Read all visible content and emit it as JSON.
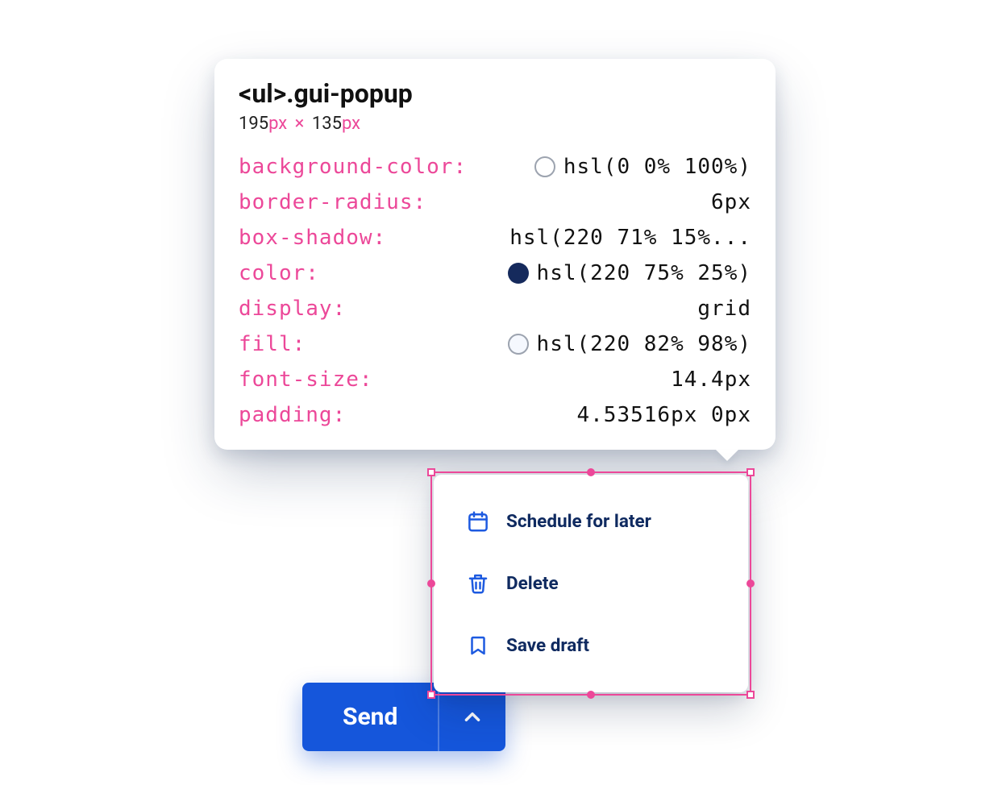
{
  "tooltip": {
    "element_tag": "<ul>",
    "element_class": ".gui-popup",
    "dims": {
      "w": "195",
      "w_unit": "px",
      "sep": "×",
      "h": "135",
      "h_unit": "px"
    },
    "rows": [
      {
        "key": "background-color",
        "value": "hsl(0 0% 100%)",
        "swatch": "#ffffff",
        "swatch_border": true
      },
      {
        "key": "border-radius",
        "value": "6px"
      },
      {
        "key": "box-shadow",
        "value": "hsl(220 71% 15%..."
      },
      {
        "key": "color",
        "value": "hsl(220 75% 25%)",
        "swatch": "#152a5c",
        "swatch_border": false
      },
      {
        "key": "display",
        "value": "grid"
      },
      {
        "key": "fill",
        "value": "hsl(220 82% 98%)",
        "swatch": "#f5f8fe",
        "swatch_border": true
      },
      {
        "key": "font-size",
        "value": "14.4px"
      },
      {
        "key": "padding",
        "value": "4.53516px 0px"
      }
    ]
  },
  "popup": {
    "items": [
      {
        "icon": "calendar-icon",
        "label": "Schedule for later"
      },
      {
        "icon": "trash-icon",
        "label": "Delete"
      },
      {
        "icon": "bookmark-icon",
        "label": "Save draft"
      }
    ]
  },
  "sendbar": {
    "primary_label": "Send"
  },
  "colors": {
    "accent_pink": "#ec4899",
    "brand_blue": "#1556db",
    "popup_text": "#0f2a60",
    "popup_icon": "#1d5ae0"
  }
}
